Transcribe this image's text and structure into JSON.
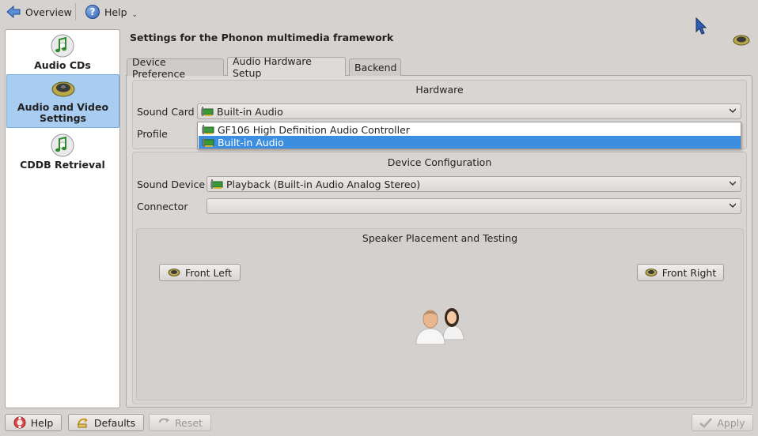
{
  "toolbar": {
    "overview_label": "Overview",
    "help_label": "Help"
  },
  "sidebar": {
    "items": [
      {
        "label": "Audio CDs",
        "icon": "music-note-cd-icon",
        "selected": false
      },
      {
        "label": "Audio and Video Settings",
        "icon": "speaker-icon",
        "selected": true
      },
      {
        "label": "CDDB Retrieval",
        "icon": "music-note-cd-icon",
        "selected": false
      }
    ]
  },
  "main": {
    "title": "Settings for the Phonon multimedia framework",
    "tabs": [
      {
        "label": "Device Preference",
        "active": false
      },
      {
        "label": "Audio Hardware Setup",
        "active": true
      },
      {
        "label": "Backend",
        "active": false
      }
    ],
    "hardware": {
      "title": "Hardware",
      "sound_card_label": "Sound Card",
      "sound_card_value": "Built-in Audio",
      "profile_label": "Profile",
      "dropdown_options": [
        {
          "label": "GF106 High Definition Audio Controller",
          "selected": false
        },
        {
          "label": "Built-in Audio",
          "selected": true
        }
      ]
    },
    "device_config": {
      "title": "Device Configuration",
      "sound_device_label": "Sound Device",
      "sound_device_value": "Playback (Built-in Audio Analog Stereo)",
      "connector_label": "Connector",
      "connector_value": ""
    },
    "speaker": {
      "title": "Speaker Placement and Testing",
      "front_left_label": "Front Left",
      "front_right_label": "Front Right"
    }
  },
  "footer": {
    "help_label": "Help",
    "defaults_label": "Defaults",
    "reset_label": "Reset",
    "apply_label": "Apply"
  },
  "colors": {
    "selection": "#3b8ee0",
    "sidebar_selection": "#a9cdf0",
    "window_bg": "#d6d2d0"
  }
}
